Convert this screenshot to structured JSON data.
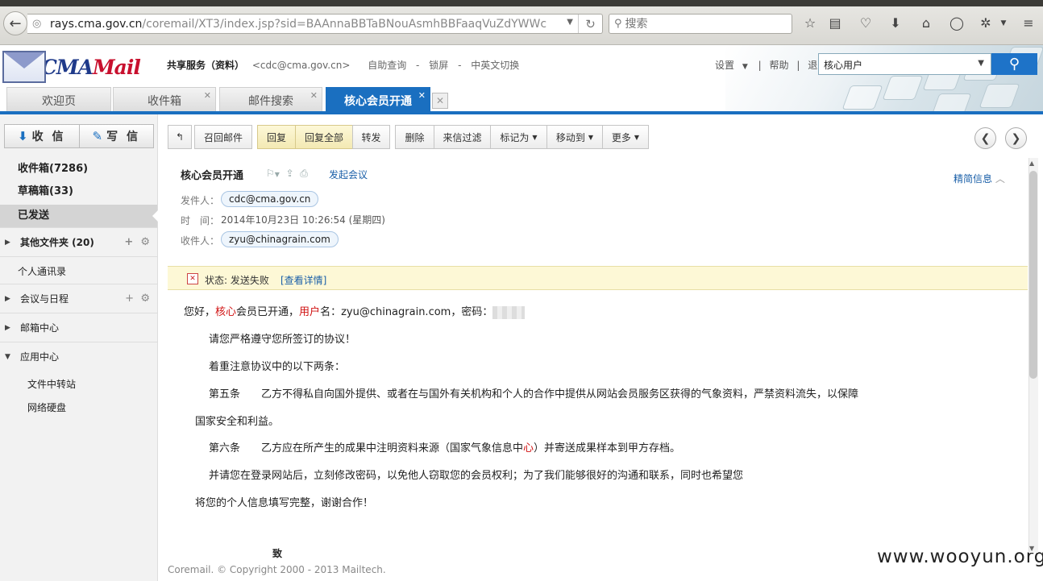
{
  "browser": {
    "url_domain": "rays.cma.gov.cn",
    "url_path": "/coremail/XT3/index.jsp?sid=BAAnnaBBTaBNouAsmhBBFaaqVuZdYWWc",
    "search_placeholder": "搜索"
  },
  "header": {
    "logo_text_a": "CMA",
    "logo_text_b": "Mail",
    "account_name": "共享服务（资料）",
    "account_email": "<cdc@cma.gov.cn>",
    "link_selfquery": "自助查询",
    "link_lock": "锁屏",
    "link_lang": "中英文切换",
    "sep": "-",
    "settings": "设置",
    "help": "帮助",
    "logout": "退出",
    "bar": "|",
    "user_select": "核心用户"
  },
  "tabs": [
    {
      "label": "欢迎页"
    },
    {
      "label": "收件箱"
    },
    {
      "label": "邮件搜索"
    },
    {
      "label": "核心会员开通"
    }
  ],
  "sidebar": {
    "receive": "收 信",
    "write": "写 信",
    "inbox": "收件箱(7286)",
    "drafts": "草稿箱(33)",
    "sent": "已发送",
    "other_folders": "其他文件夹 (20)",
    "contacts": "个人通讯录",
    "calendar": "会议与日程",
    "mailbox_center": "邮箱中心",
    "app_center": "应用中心",
    "file_transfer": "文件中转站",
    "netdisk": "网络硬盘"
  },
  "toolbar": {
    "recall": "召回邮件",
    "reply": "回复",
    "reply_all": "回复全部",
    "forward": "转发",
    "delete": "删除",
    "filter": "来信过滤",
    "mark_as": "标记为",
    "move_to": "移动到",
    "more": "更多"
  },
  "message": {
    "subject": "核心会员开通",
    "start_meeting": "发起会议",
    "details": "精简信息",
    "from_label": "发件人：",
    "from": "cdc@cma.gov.cn",
    "time_label": "时　间：",
    "time": "2014年10月23日 10:26:54 (星期四)",
    "to_label": "收件人：",
    "to": "zyu@chinagrain.com",
    "status_label": "状态: 发送失败",
    "status_link": "[查看详情]",
    "greet_1": "您好，",
    "greet_core": "核心",
    "greet_2": "会员已开通，",
    "greet_user": "用户",
    "greet_3": "名：zyu@chinagrain.com，密码：",
    "p1": "请您严格遵守您所签订的协议！",
    "p2": "着重注意协议中的以下两条：",
    "p3": "第五条　　乙方不得私自向国外提供、或者在与国外有关机构和个人的合作中提供从网站会员服务区获得的气象资料，严禁资料流失，以保障",
    "p4": "国家安全和利益。",
    "p5a": "第六条　　乙方应在所产生的成果中注明资料来源（国家气象信息中",
    "p5b": "心",
    "p5c": "）并寄送成果样本到甲方存档。",
    "p6": "并请您在登录网站后，立刻修改密码，以免他人窃取您的会员权利；为了我们能够很好的沟通和联系，同时也希望您",
    "p7": "将您的个人信息填写完整，谢谢合作！",
    "p8": "致"
  },
  "footer": "Coremail. © Copyright 2000 - 2013 Mailtech.",
  "watermark": "www.wooyun.org"
}
